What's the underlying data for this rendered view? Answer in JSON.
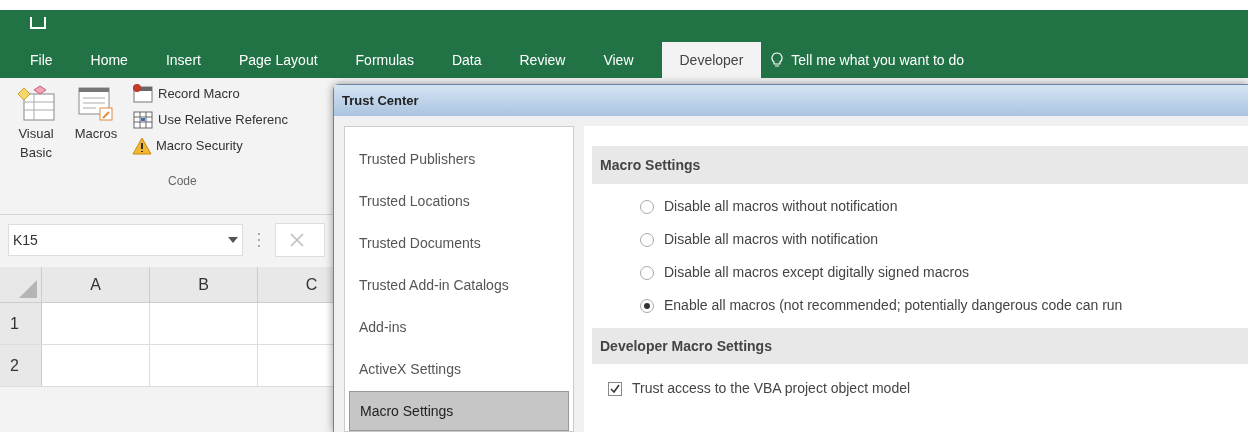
{
  "ribbon_tabs": [
    {
      "label": "File",
      "selected": false
    },
    {
      "label": "Home",
      "selected": false
    },
    {
      "label": "Insert",
      "selected": false
    },
    {
      "label": "Page Layout",
      "selected": false
    },
    {
      "label": "Formulas",
      "selected": false
    },
    {
      "label": "Data",
      "selected": false
    },
    {
      "label": "Review",
      "selected": false
    },
    {
      "label": "View",
      "selected": false
    },
    {
      "label": "Developer",
      "selected": true
    }
  ],
  "tell_me": {
    "placeholder": "Tell me what you want to do"
  },
  "code_group": {
    "label": "Code",
    "large_buttons": [
      {
        "kind": "vba",
        "label": "Visual Basic"
      },
      {
        "kind": "macros",
        "label": "Macros"
      }
    ],
    "small_buttons": [
      {
        "kind": "record",
        "label": "Record Macro"
      },
      {
        "kind": "relative",
        "label": "Use Relative Referenc"
      },
      {
        "kind": "security",
        "label": "Macro Security"
      }
    ]
  },
  "name_box": {
    "value": "K15"
  },
  "columns": [
    "A",
    "B",
    "C"
  ],
  "rows": [
    "1",
    "2"
  ],
  "dialog": {
    "title": "Trust Center",
    "nav_items": [
      {
        "label": "Trusted Publishers",
        "selected": false
      },
      {
        "label": "Trusted Locations",
        "selected": false
      },
      {
        "label": "Trusted Documents",
        "selected": false
      },
      {
        "label": "Trusted Add-in Catalogs",
        "selected": false
      },
      {
        "label": "Add-ins",
        "selected": false
      },
      {
        "label": "ActiveX Settings",
        "selected": false
      },
      {
        "label": "Macro Settings",
        "selected": true
      }
    ],
    "macro_settings": {
      "heading": "Macro Settings",
      "options": [
        {
          "label": "Disable all macros without notification",
          "selected": false
        },
        {
          "label": "Disable all macros with notification",
          "selected": false
        },
        {
          "label": "Disable all macros except digitally signed macros",
          "selected": false
        },
        {
          "label": "Enable all macros (not recommended; potentially dangerous code can run",
          "selected": true
        }
      ]
    },
    "developer_settings": {
      "heading": "Developer Macro Settings",
      "options": [
        {
          "label": "Trust access to the VBA project object model",
          "checked": true
        }
      ]
    }
  }
}
